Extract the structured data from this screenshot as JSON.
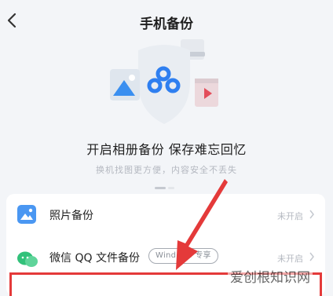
{
  "header": {
    "title": "手机备份"
  },
  "corner_text": "",
  "hero": {
    "tagline": "开启相册备份 保存难忘回忆",
    "subline": "换机找图更方便，内容安全不丢失"
  },
  "rows": [
    {
      "label": "照片备份",
      "status": "未开启"
    },
    {
      "label": "微信 QQ 文件备份",
      "badge": "Windows 专享",
      "status": "未开启"
    }
  ],
  "watermark": "爱创根知识网",
  "colors": {
    "accent": "#3a86ff",
    "highlight": "#e43a3a"
  }
}
